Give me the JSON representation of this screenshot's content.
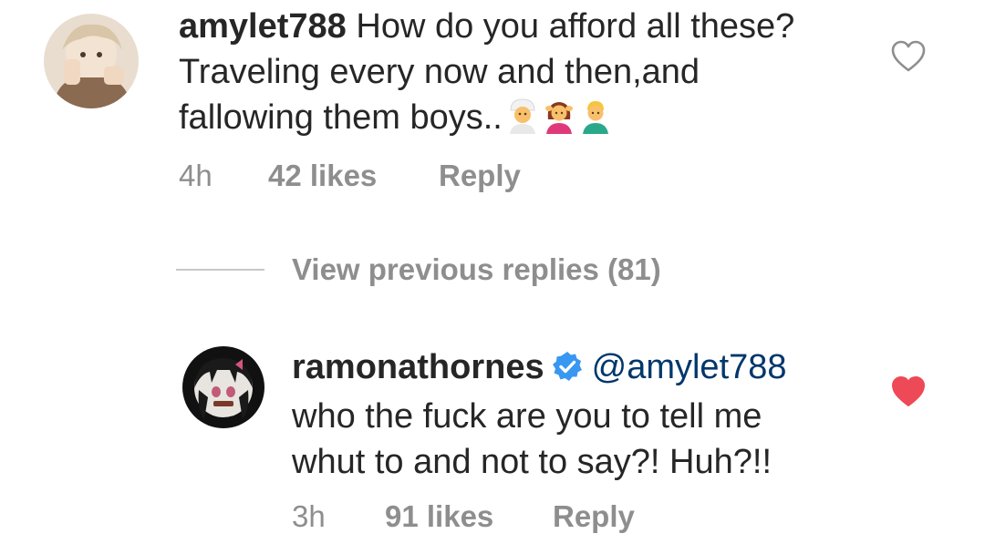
{
  "comment1": {
    "username": "amylet788",
    "lines": [
      "How do you afford all these?",
      "Traveling every now and then,and",
      "fallowing them boys.."
    ],
    "emojis": [
      "man-with-turban-emoji",
      "woman-getting-massage-emoji",
      "man-emoji"
    ],
    "time": "4h",
    "likes": "42 likes",
    "reply": "Reply",
    "liked": false,
    "heart_color": "#8e8e8e"
  },
  "view_previous": {
    "label": "View previous replies (81)"
  },
  "comment2": {
    "username": "ramonathornes",
    "verified": true,
    "mention": "@amylet788",
    "lines": [
      "who the fuck are you to tell me",
      "whut to and not to say?! Huh?!!"
    ],
    "time": "3h",
    "likes": "91 likes",
    "reply": "Reply",
    "liked": true,
    "heart_color": "#ed4956"
  },
  "colors": {
    "text": "#262626",
    "secondary": "#8e8e8e",
    "mention": "#00376b",
    "verified": "#3897f0",
    "liked": "#ed4956"
  }
}
